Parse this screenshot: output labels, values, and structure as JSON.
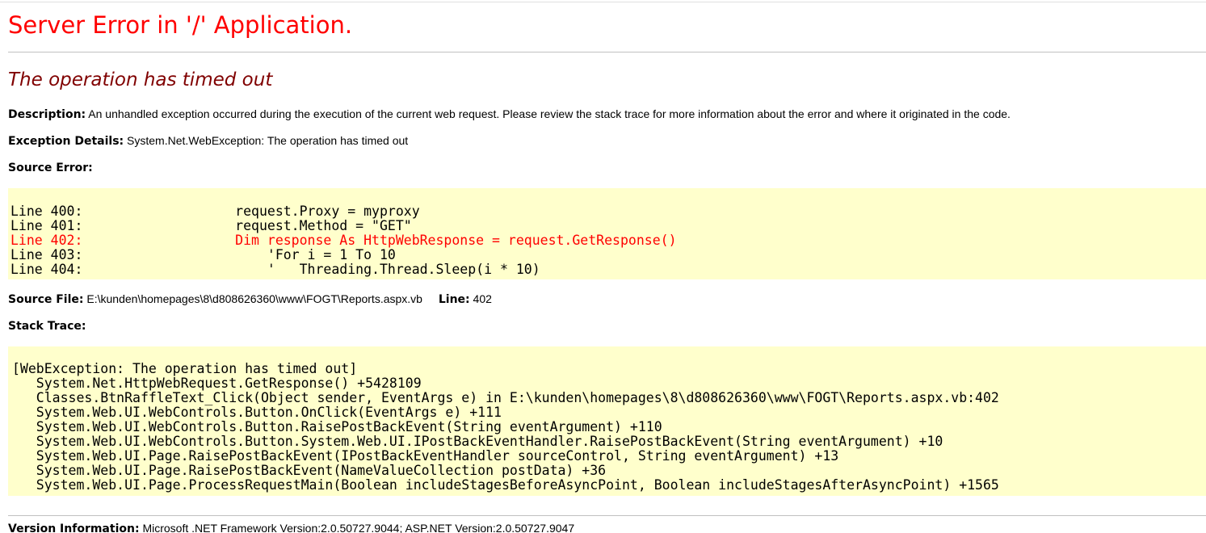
{
  "page": {
    "title": "Server Error in '/' Application.",
    "error_message": "The operation has timed out"
  },
  "description": {
    "label": "Description:",
    "text": "An unhandled exception occurred during the execution of the current web request. Please review the stack trace for more information about the error and where it originated in the code."
  },
  "exception_details": {
    "label": "Exception Details:",
    "text": "System.Net.WebException: The operation has timed out"
  },
  "source_error": {
    "label": "Source Error:",
    "lines": [
      "Line 400:                   request.Proxy = myproxy",
      "Line 401:                   request.Method = \"GET\"",
      "Line 402:                   Dim response As HttpWebResponse = request.GetResponse()",
      "Line 403:                       'For i = 1 To 10",
      "Line 404:                       '   Threading.Thread.Sleep(i * 10)"
    ],
    "highlighted_line": "Line 402"
  },
  "source_file": {
    "label": "Source File:",
    "path": "E:\\kunden\\homepages\\8\\d808626360\\www\\FOGT\\Reports.aspx.vb",
    "line_label": "Line:",
    "line_number": "402"
  },
  "stack_trace": {
    "label": "Stack Trace:",
    "lines": [
      "[WebException: The operation has timed out]",
      "   System.Net.HttpWebRequest.GetResponse() +5428109",
      "   Classes.BtnRaffleText_Click(Object sender, EventArgs e) in E:\\kunden\\homepages\\8\\d808626360\\www\\FOGT\\Reports.aspx.vb:402",
      "   System.Web.UI.WebControls.Button.OnClick(EventArgs e) +111",
      "   System.Web.UI.WebControls.Button.RaisePostBackEvent(String eventArgument) +110",
      "   System.Web.UI.WebControls.Button.System.Web.UI.IPostBackEventHandler.RaisePostBackEvent(String eventArgument) +10",
      "   System.Web.UI.Page.RaisePostBackEvent(IPostBackEventHandler sourceControl, String eventArgument) +13",
      "   System.Web.UI.Page.RaisePostBackEvent(NameValueCollection postData) +36",
      "   System.Web.UI.Page.ProcessRequestMain(Boolean includeStagesBeforeAsyncPoint, Boolean includeStagesAfterAsyncPoint) +1565"
    ]
  },
  "version_info": {
    "label": "Version Information:",
    "text": "Microsoft .NET Framework Version:2.0.50727.9044; ASP.NET Version:2.0.50727.9047"
  },
  "colors": {
    "title": "#ff0000",
    "error_message": "#800000",
    "code_background": "#ffffcc",
    "highlight_line": "#ff0000"
  }
}
